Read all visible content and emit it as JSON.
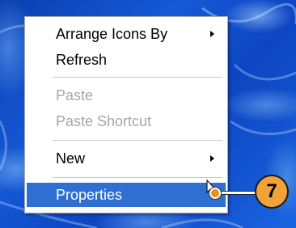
{
  "context_menu": {
    "items": [
      {
        "label": "Arrange Icons By",
        "state": "normal",
        "has_submenu": true
      },
      {
        "label": "Refresh",
        "state": "normal",
        "has_submenu": false
      },
      {
        "label": "Paste",
        "state": "disabled",
        "has_submenu": false
      },
      {
        "label": "Paste Shortcut",
        "state": "disabled",
        "has_submenu": false
      },
      {
        "label": "New",
        "state": "normal",
        "has_submenu": true
      },
      {
        "label": "Properties",
        "state": "highlighted",
        "has_submenu": false
      }
    ],
    "highlight_color": "#2f6fd2",
    "disabled_color": "#a6a6a6"
  },
  "callout": {
    "number": "7",
    "color": "#f1a33a"
  },
  "icons": [
    "submenu-arrow-icon",
    "mouse-pointer-icon"
  ]
}
